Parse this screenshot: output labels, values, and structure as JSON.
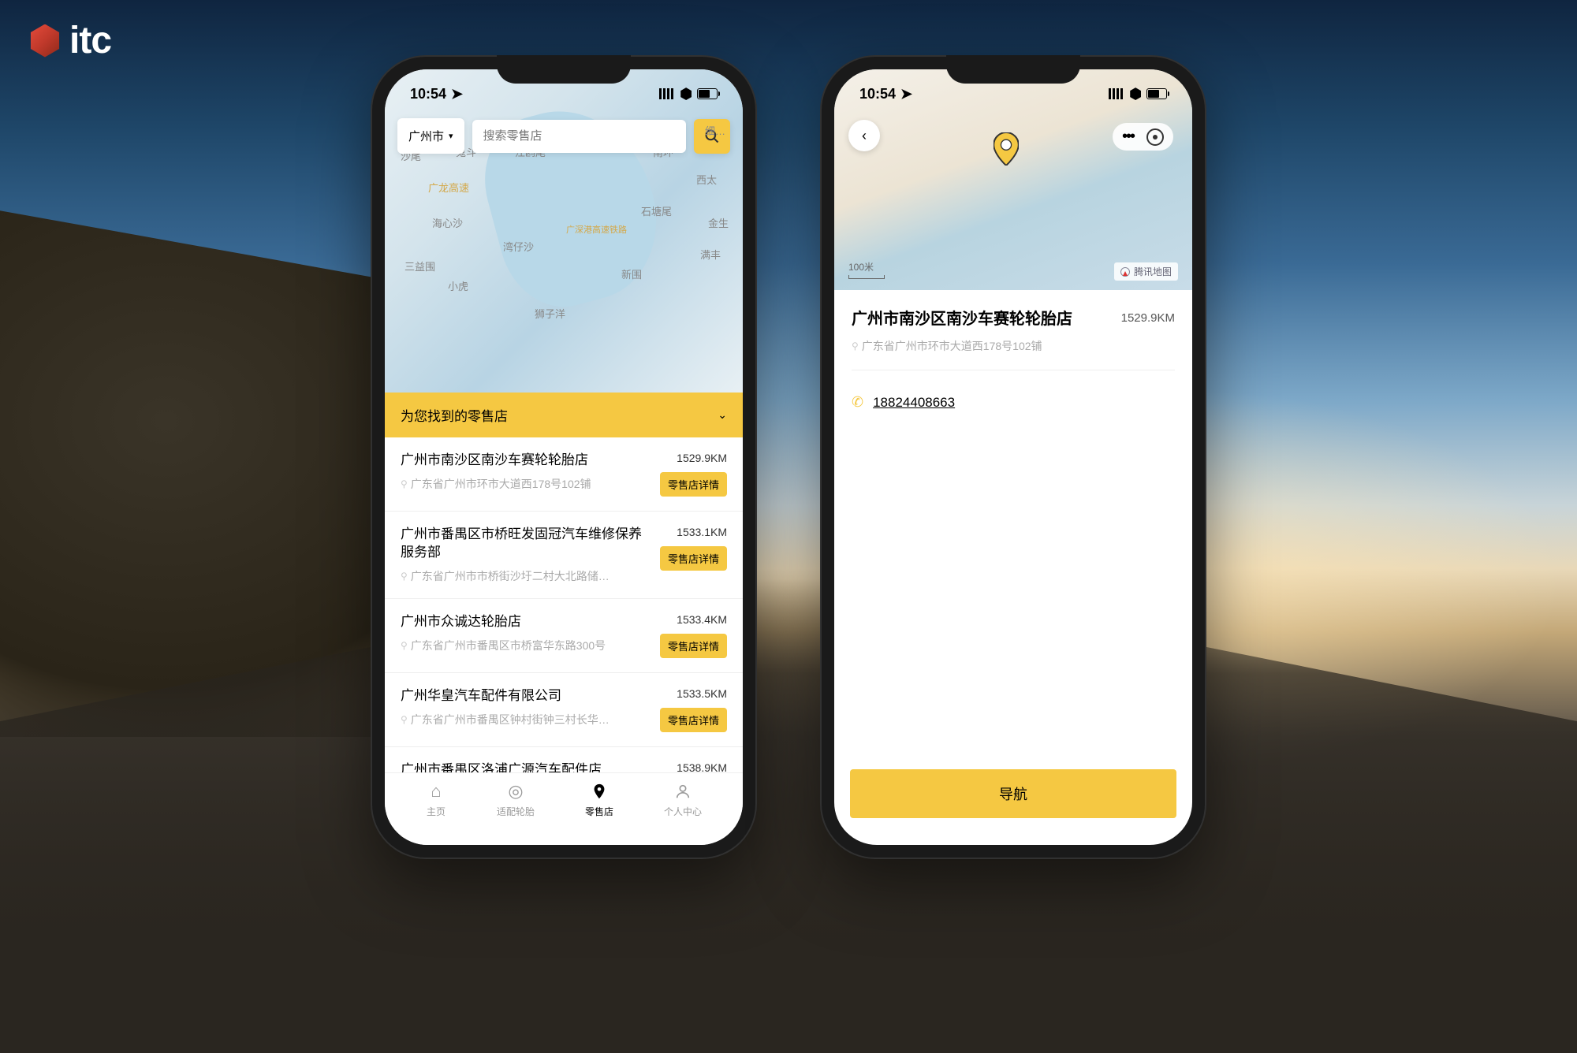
{
  "brand": {
    "name": "itc"
  },
  "statusBar": {
    "time": "10:54"
  },
  "colors": {
    "accent": "#f5c842"
  },
  "phone1": {
    "city": "广州市",
    "searchPlaceholder": "搜索零售店",
    "mapLabels": [
      "沙尾",
      "鬼斗",
      "江鸥尾",
      "南环",
      "西太",
      "广龙高速",
      "海心沙",
      "湾仔沙",
      "广深港高速铁路",
      "石塘尾",
      "金生",
      "满丰",
      "三益围",
      "小虎",
      "新围",
      "狮子洋"
    ],
    "resultsHeader": "为您找到的零售店",
    "detailBtnLabel": "零售店详情",
    "stores": [
      {
        "name": "广州市南沙区南沙车赛轮轮胎店",
        "address": "广东省广州市环市大道西178号102铺",
        "distance": "1529.9KM"
      },
      {
        "name": "广州市番禺区市桥旺发固冠汽车维修保养服务部",
        "address": "广东省广州市市桥街沙圩二村大北路储…",
        "distance": "1533.1KM"
      },
      {
        "name": "广州市众诚达轮胎店",
        "address": "广东省广州市番禺区市桥富华东路300号",
        "distance": "1533.4KM"
      },
      {
        "name": "广州华皇汽车配件有限公司",
        "address": "广东省广州市番禺区钟村街钟三村长华…",
        "distance": "1533.5KM"
      },
      {
        "name": "广州市番禺区洛浦广源汽车配件店",
        "address": "",
        "distance": "1538.9KM"
      }
    ],
    "tabs": [
      {
        "label": "主页",
        "icon": "home"
      },
      {
        "label": "适配轮胎",
        "icon": "tire"
      },
      {
        "label": "零售店",
        "icon": "pin"
      },
      {
        "label": "个人中心",
        "icon": "person"
      }
    ]
  },
  "phone2": {
    "scaleLabel": "100米",
    "mapAttribution": "腾讯地图",
    "title": "广州市南沙区南沙车赛轮轮胎店",
    "distance": "1529.9KM",
    "address": "广东省广州市环市大道西178号102铺",
    "phoneNumber": "18824408663",
    "navLabel": "导航"
  },
  "miniControls": {
    "extra": "细…"
  }
}
